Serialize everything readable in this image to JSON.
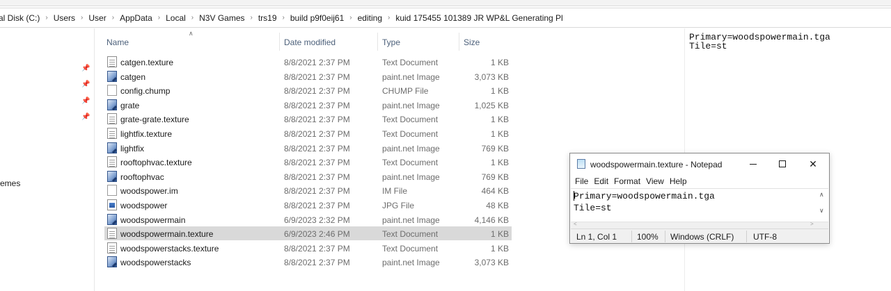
{
  "address_bar": {
    "crumbs": [
      "al Disk (C:)",
      "Users",
      "User",
      "AppData",
      "Local",
      "N3V Games",
      "trs19",
      "build p9f0eij61",
      "editing",
      "kuid 175455 101389 JR WP&L Generating Pl"
    ]
  },
  "nav": {
    "label": "emes"
  },
  "columns": {
    "name": "Name",
    "date": "Date modified",
    "type": "Type",
    "size": "Size"
  },
  "files": [
    {
      "name": "catgen.texture",
      "date": "8/8/2021 2:37 PM",
      "type": "Text Document",
      "size": "1 KB",
      "icon": "text-document-icon"
    },
    {
      "name": "catgen",
      "date": "8/8/2021 2:37 PM",
      "type": "paint.net Image",
      "size": "3,073 KB",
      "icon": "paintnet-image-icon"
    },
    {
      "name": "config.chump",
      "date": "8/8/2021 2:37 PM",
      "type": "CHUMP File",
      "size": "1 KB",
      "icon": "blank-file-icon"
    },
    {
      "name": "grate",
      "date": "8/8/2021 2:37 PM",
      "type": "paint.net Image",
      "size": "1,025 KB",
      "icon": "paintnet-image-icon"
    },
    {
      "name": "grate-grate.texture",
      "date": "8/8/2021 2:37 PM",
      "type": "Text Document",
      "size": "1 KB",
      "icon": "text-document-icon"
    },
    {
      "name": "lightfix.texture",
      "date": "8/8/2021 2:37 PM",
      "type": "Text Document",
      "size": "1 KB",
      "icon": "text-document-icon"
    },
    {
      "name": "lightfix",
      "date": "8/8/2021 2:37 PM",
      "type": "paint.net Image",
      "size": "769 KB",
      "icon": "paintnet-image-icon"
    },
    {
      "name": "rooftophvac.texture",
      "date": "8/8/2021 2:37 PM",
      "type": "Text Document",
      "size": "1 KB",
      "icon": "text-document-icon"
    },
    {
      "name": "rooftophvac",
      "date": "8/8/2021 2:37 PM",
      "type": "paint.net Image",
      "size": "769 KB",
      "icon": "paintnet-image-icon"
    },
    {
      "name": "woodspower.im",
      "date": "8/8/2021 2:37 PM",
      "type": "IM File",
      "size": "464 KB",
      "icon": "blank-file-icon"
    },
    {
      "name": "woodspower",
      "date": "8/8/2021 2:37 PM",
      "type": "JPG File",
      "size": "48 KB",
      "icon": "jpg-file-icon"
    },
    {
      "name": "woodspowermain",
      "date": "6/9/2023 2:32 PM",
      "type": "paint.net Image",
      "size": "4,146 KB",
      "icon": "paintnet-image-icon"
    },
    {
      "name": "woodspowermain.texture",
      "date": "6/9/2023 2:46 PM",
      "type": "Text Document",
      "size": "1 KB",
      "icon": "text-document-icon",
      "selected": true
    },
    {
      "name": "woodspowerstacks.texture",
      "date": "8/8/2021 2:37 PM",
      "type": "Text Document",
      "size": "1 KB",
      "icon": "text-document-icon"
    },
    {
      "name": "woodspowerstacks",
      "date": "8/8/2021 2:37 PM",
      "type": "paint.net Image",
      "size": "3,073 KB",
      "icon": "paintnet-image-icon"
    }
  ],
  "preview": {
    "line1": "Primary=woodspowermain.tga",
    "line2": "Tile=st"
  },
  "notepad": {
    "title": "woodspowermain.texture - Notepad",
    "menu": [
      "File",
      "Edit",
      "Format",
      "View",
      "Help"
    ],
    "content": "Primary=woodspowermain.tga\nTile=st",
    "status": {
      "position": "Ln 1, Col 1",
      "zoom": "100%",
      "line_ending": "Windows (CRLF)",
      "encoding": "UTF-8"
    }
  }
}
